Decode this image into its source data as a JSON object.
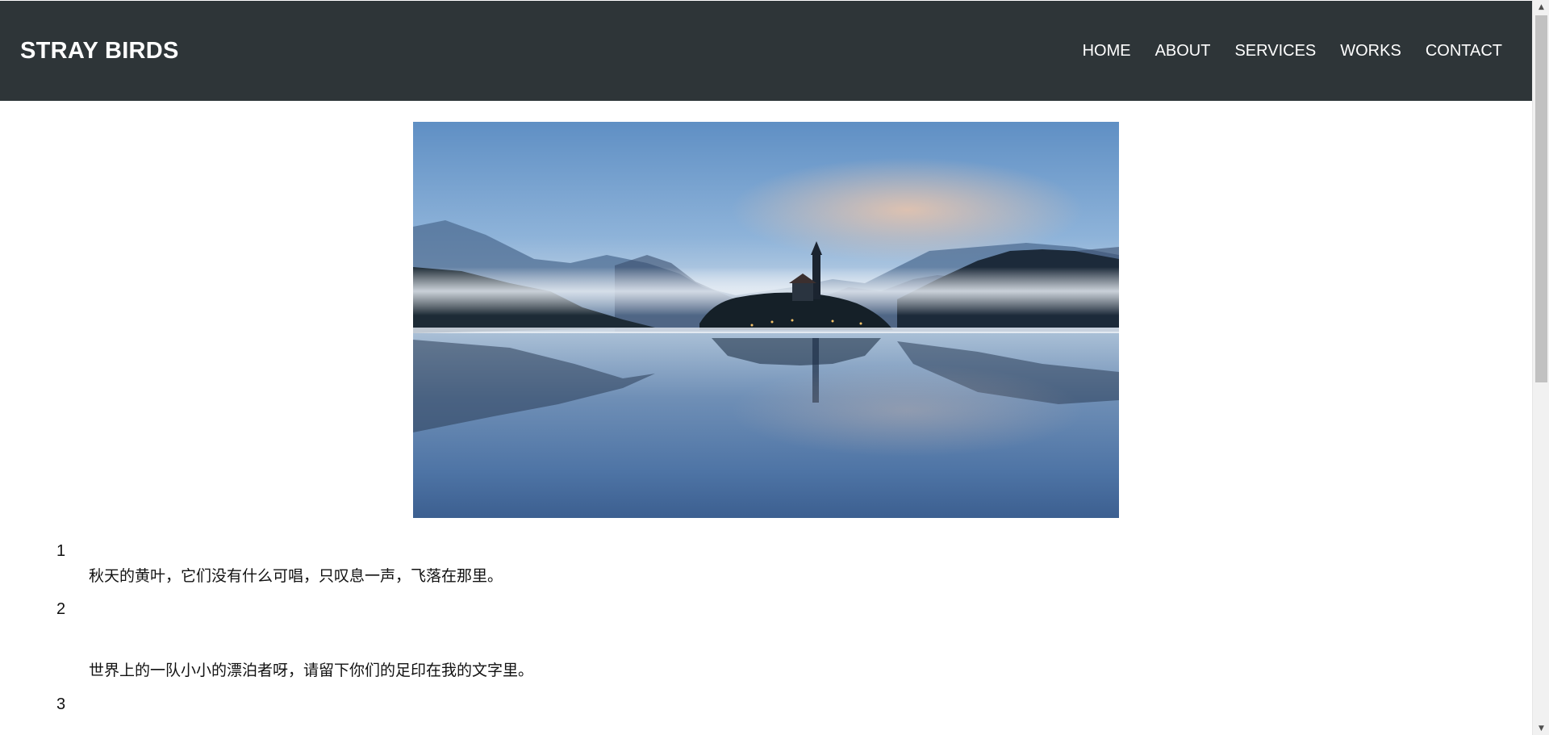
{
  "header": {
    "brand": "STRAY BIRDS",
    "nav": [
      {
        "label": "HOME"
      },
      {
        "label": "ABOUT"
      },
      {
        "label": "SERVICES"
      },
      {
        "label": "WORKS"
      },
      {
        "label": "CONTACT"
      }
    ]
  },
  "hero": {
    "icon": "lake-island-church-photo"
  },
  "poems": [
    {
      "number": "1",
      "text": "秋天的黄叶，它们没有什么可唱，只叹息一声，飞落在那里。"
    },
    {
      "number": "2",
      "text": "世界上的一队小小的漂泊者呀，请留下你们的足印在我的文字里。"
    },
    {
      "number": "3",
      "text": ""
    }
  ],
  "colors": {
    "header_bg": "#2e3538",
    "nav_text": "#ffffff",
    "page_bg": "#ffffff"
  }
}
